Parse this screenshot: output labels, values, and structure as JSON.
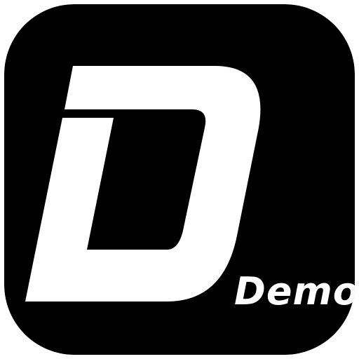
{
  "app_icon": {
    "logo_text": "Demo",
    "background_color": "#000000",
    "foreground_color": "#ffffff",
    "page_background": "#ffffff",
    "icon": "demo-d-logo-icon"
  }
}
